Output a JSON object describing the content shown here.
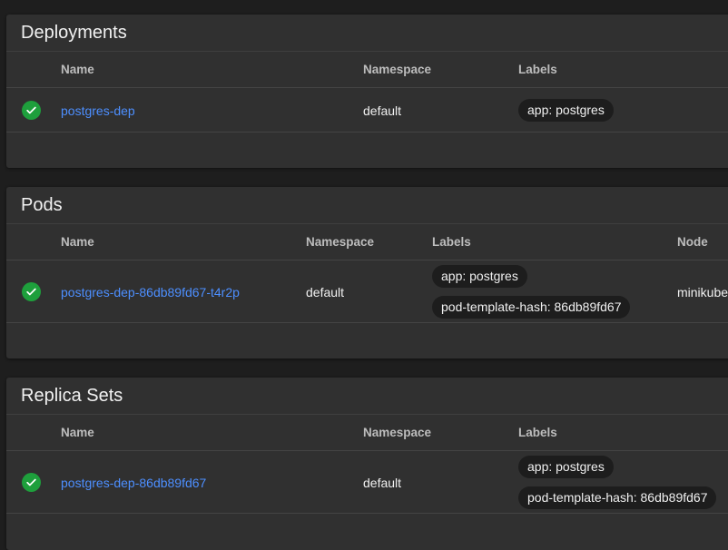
{
  "deployments": {
    "title": "Deployments",
    "columns": [
      "Name",
      "Namespace",
      "Labels"
    ],
    "rows": [
      {
        "status": "ok",
        "name": "postgres-dep",
        "namespace": "default",
        "labels": [
          "app: postgres"
        ]
      }
    ]
  },
  "pods": {
    "title": "Pods",
    "columns": [
      "Name",
      "Namespace",
      "Labels",
      "Node"
    ],
    "rows": [
      {
        "status": "ok",
        "name": "postgres-dep-86db89fd67-t4r2p",
        "namespace": "default",
        "labels": [
          "app: postgres",
          "pod-template-hash: 86db89fd67"
        ],
        "node": "minikube"
      }
    ]
  },
  "replica_sets": {
    "title": "Replica Sets",
    "columns": [
      "Name",
      "Namespace",
      "Labels"
    ],
    "rows": [
      {
        "status": "ok",
        "name": "postgres-dep-86db89fd67",
        "namespace": "default",
        "labels": [
          "app: postgres",
          "pod-template-hash: 86db89fd67"
        ]
      }
    ]
  },
  "colors": {
    "link": "#4d8fff",
    "status_ok": "#1e9f3c",
    "card": "#303030",
    "chip": "#1d1d1d"
  },
  "icons": {
    "status_ok": "check-circle-icon"
  }
}
